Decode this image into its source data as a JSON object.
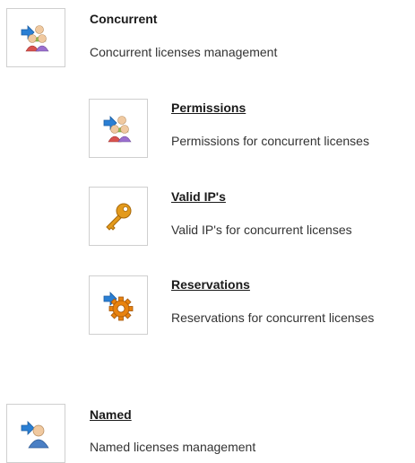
{
  "sections": [
    {
      "id": "concurrent",
      "title": "Concurrent",
      "description": "Concurrent licenses management",
      "icon": "users-group-arrow-icon"
    },
    {
      "id": "permissions",
      "title": "Permissions",
      "description": "Permissions for concurrent licenses",
      "icon": "users-group-arrow-icon"
    },
    {
      "id": "valid-ips",
      "title": "Valid IP's",
      "description": "Valid IP's for concurrent licenses",
      "icon": "key-icon"
    },
    {
      "id": "reservations",
      "title": "Reservations",
      "description": "Reservations for concurrent licenses",
      "icon": "gear-arrow-icon"
    },
    {
      "id": "named",
      "title": "Named",
      "description": "Named licenses management",
      "icon": "user-arrow-icon"
    }
  ],
  "colors": {
    "tile_border": "#cfcfcf",
    "arrow_blue": "#2a7fd4",
    "key_orange": "#e39a1c",
    "gear_orange": "#e8820e",
    "user_blue": "#4a7fc4"
  }
}
